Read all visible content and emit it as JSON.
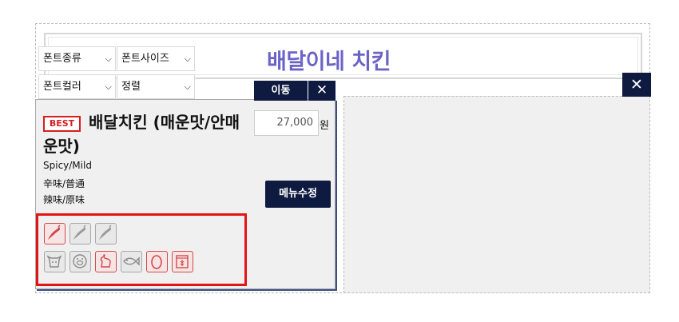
{
  "header": {
    "title": "배달이네 치킨"
  },
  "font_controls": {
    "font_family": "폰트종류",
    "font_size": "폰트사이즈",
    "font_color": "폰트컬러",
    "align": "정렬"
  },
  "panel": {
    "move_label": "이동",
    "close_glyph": "✕"
  },
  "menu_item": {
    "badge": "BEST",
    "name": "배달치킨 (매운맛/안매운맛)",
    "desc_en": "Spicy/Mild",
    "desc_jp": "辛味/普通",
    "desc_cn": "辣味/原味",
    "price": "27,000",
    "currency": "원",
    "edit_label": "메뉴수정",
    "spice_icons": [
      {
        "name": "pepper-icon",
        "active": true
      },
      {
        "name": "pepper-icon",
        "active": false
      },
      {
        "name": "pepper-icon",
        "active": false
      }
    ],
    "ingredient_icons": [
      {
        "name": "beef-icon",
        "active": false
      },
      {
        "name": "pork-icon",
        "active": false
      },
      {
        "name": "chicken-icon",
        "active": true
      },
      {
        "name": "fish-icon",
        "active": false
      },
      {
        "name": "egg-icon",
        "active": true
      },
      {
        "name": "wheat-icon",
        "active": true
      }
    ]
  },
  "colors": {
    "accent": "#6c63c9",
    "navy": "#0e1a3f",
    "highlight": "#e31414",
    "badge": "#d32020"
  }
}
